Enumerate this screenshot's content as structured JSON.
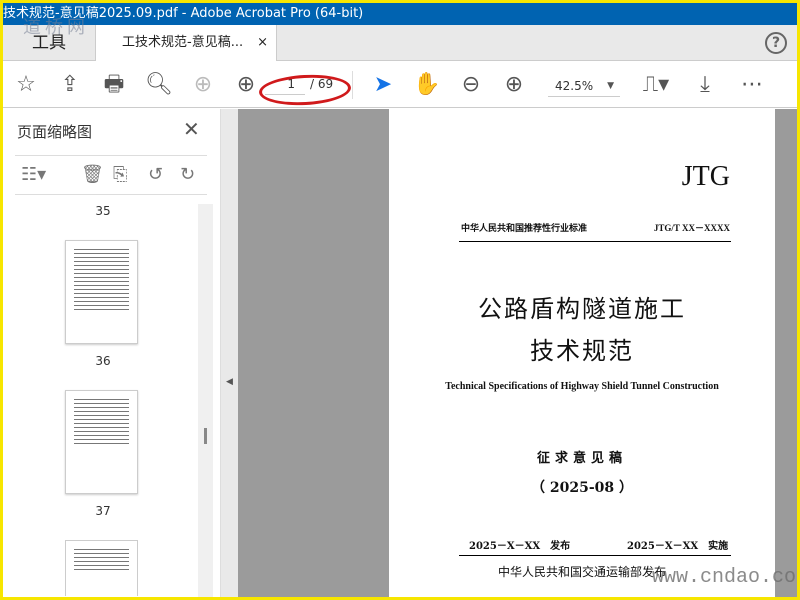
{
  "window": {
    "title": "技术规范-意见稿2025.09.pdf - Adobe Acrobat Pro (64-bit)"
  },
  "watermark": {
    "top": "道桥网",
    "bottom": "www.cndao.co"
  },
  "tabs": {
    "tools": "工具",
    "document": "工技术规范-意见稿...",
    "close": "×",
    "help": "?"
  },
  "toolbar": {
    "current_page": "1",
    "total_pages": "/ 69",
    "zoom": "42.5%"
  },
  "sidebar": {
    "title": "页面缩略图",
    "close": "✕",
    "pages": [
      "35",
      "36",
      "37"
    ]
  },
  "document": {
    "code": "JTG",
    "standard_type": "中华人民共和国推荐性行业标准",
    "standard_no": "JTG/T XX－XXXX",
    "title_line1": "公路盾构隧道施工",
    "title_line2": "技术规范",
    "title_en": "Technical Specifications of Highway Shield Tunnel Construction",
    "status": "征求意见稿",
    "date": "（ 2025-08 ）",
    "issue_date": "2025－X－XX　发布",
    "effective_date": "2025－X－XX　实施",
    "issuer": "中华人民共和国交通运输部发布"
  }
}
